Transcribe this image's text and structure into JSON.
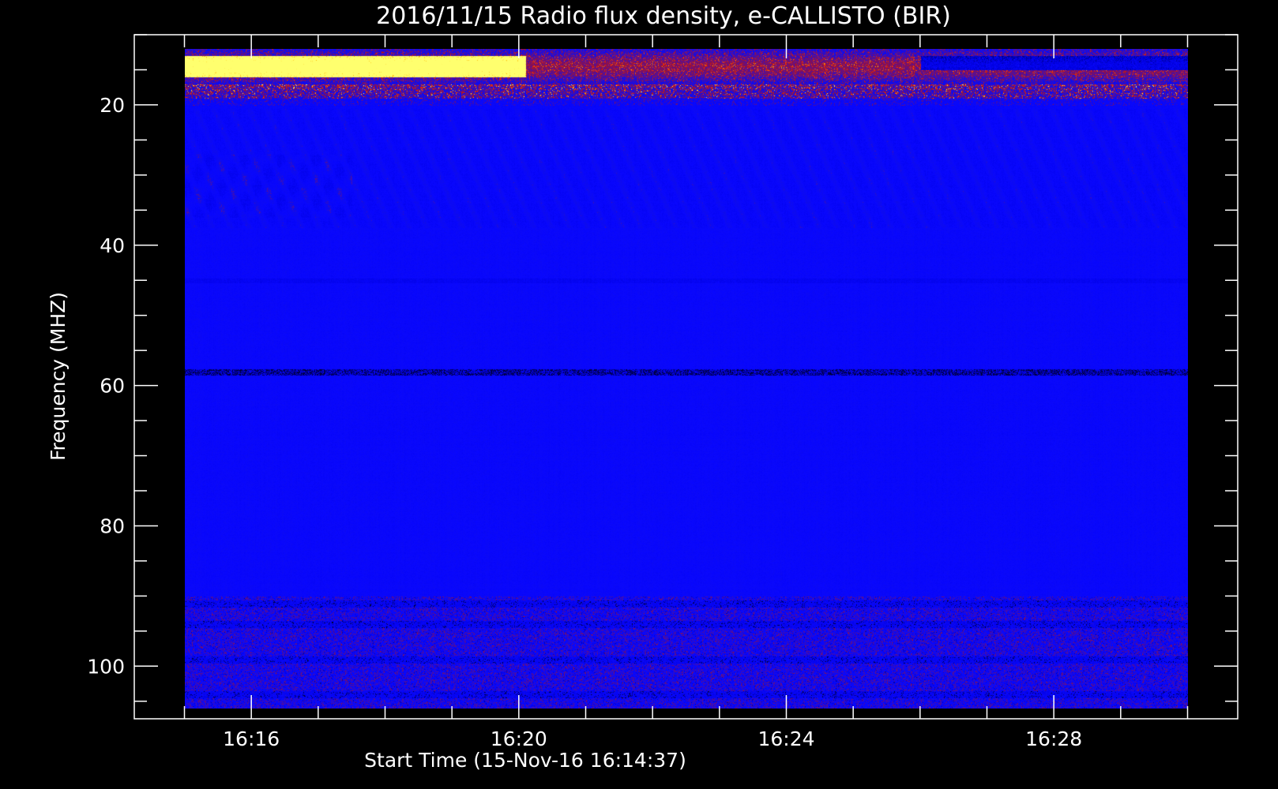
{
  "chart_data": {
    "type": "heatmap",
    "title": "2016/11/15  Radio flux density, e-CALLISTO (BIR)",
    "xlabel": "Start Time (15-Nov-16 16:14:37)",
    "ylabel": "Frequency (MHZ)",
    "x_ticks": [
      {
        "label": "16:16",
        "minutes": 16
      },
      {
        "label": "16:20",
        "minutes": 20
      },
      {
        "label": "16:24",
        "minutes": 24
      },
      {
        "label": "16:28",
        "minutes": 28
      }
    ],
    "x_minor_ticks_minutes": [
      15,
      17,
      18,
      19,
      21,
      22,
      23,
      25,
      26,
      27,
      29,
      30
    ],
    "y_ticks": [
      20,
      40,
      60,
      80,
      100
    ],
    "y_minor_ticks": [
      10,
      15,
      25,
      30,
      35,
      45,
      50,
      55,
      65,
      70,
      75,
      85,
      90,
      95,
      105
    ],
    "xlim_minutes_after_1600": [
      14.25,
      30.75
    ],
    "ylim_mhz": [
      10,
      107.5
    ],
    "y_inverted": true,
    "data_extent": {
      "time_start_minutes": 15.0,
      "time_end_minutes": 30.0,
      "freq_top_mhz": 12.0,
      "freq_bottom_mhz": 106.0
    },
    "colormap": [
      "#000000",
      "#1010ff",
      "#8a1a40",
      "#ff2000",
      "#ff9000",
      "#ffff80"
    ],
    "features": [
      {
        "label": "strong emission band",
        "freq_range_mhz": [
          12,
          17
        ],
        "time_range_minutes": [
          15.0,
          20.1
        ],
        "level": "high"
      },
      {
        "label": "intermittent emission",
        "freq_range_mhz": [
          12,
          20
        ],
        "time_range_minutes": [
          15.0,
          30.0
        ],
        "level": "medium"
      },
      {
        "label": "drifting striations",
        "freq_range_mhz": [
          21,
          37
        ],
        "time_range_minutes": [
          15.0,
          30.0
        ],
        "level": "low"
      },
      {
        "label": "dark horizontal line",
        "freq_mhz": 58,
        "time_range_minutes": [
          15.0,
          30.0
        ],
        "level": "very low"
      },
      {
        "label": "dark band",
        "freq_range_mhz": [
          13,
          15
        ],
        "time_range_minutes": [
          26.0,
          30.0
        ],
        "level": "very low"
      },
      {
        "label": "lower band noise",
        "freq_range_mhz": [
          90,
          106
        ],
        "time_range_minutes": [
          15.0,
          30.0
        ],
        "level": "low-medium"
      }
    ]
  }
}
